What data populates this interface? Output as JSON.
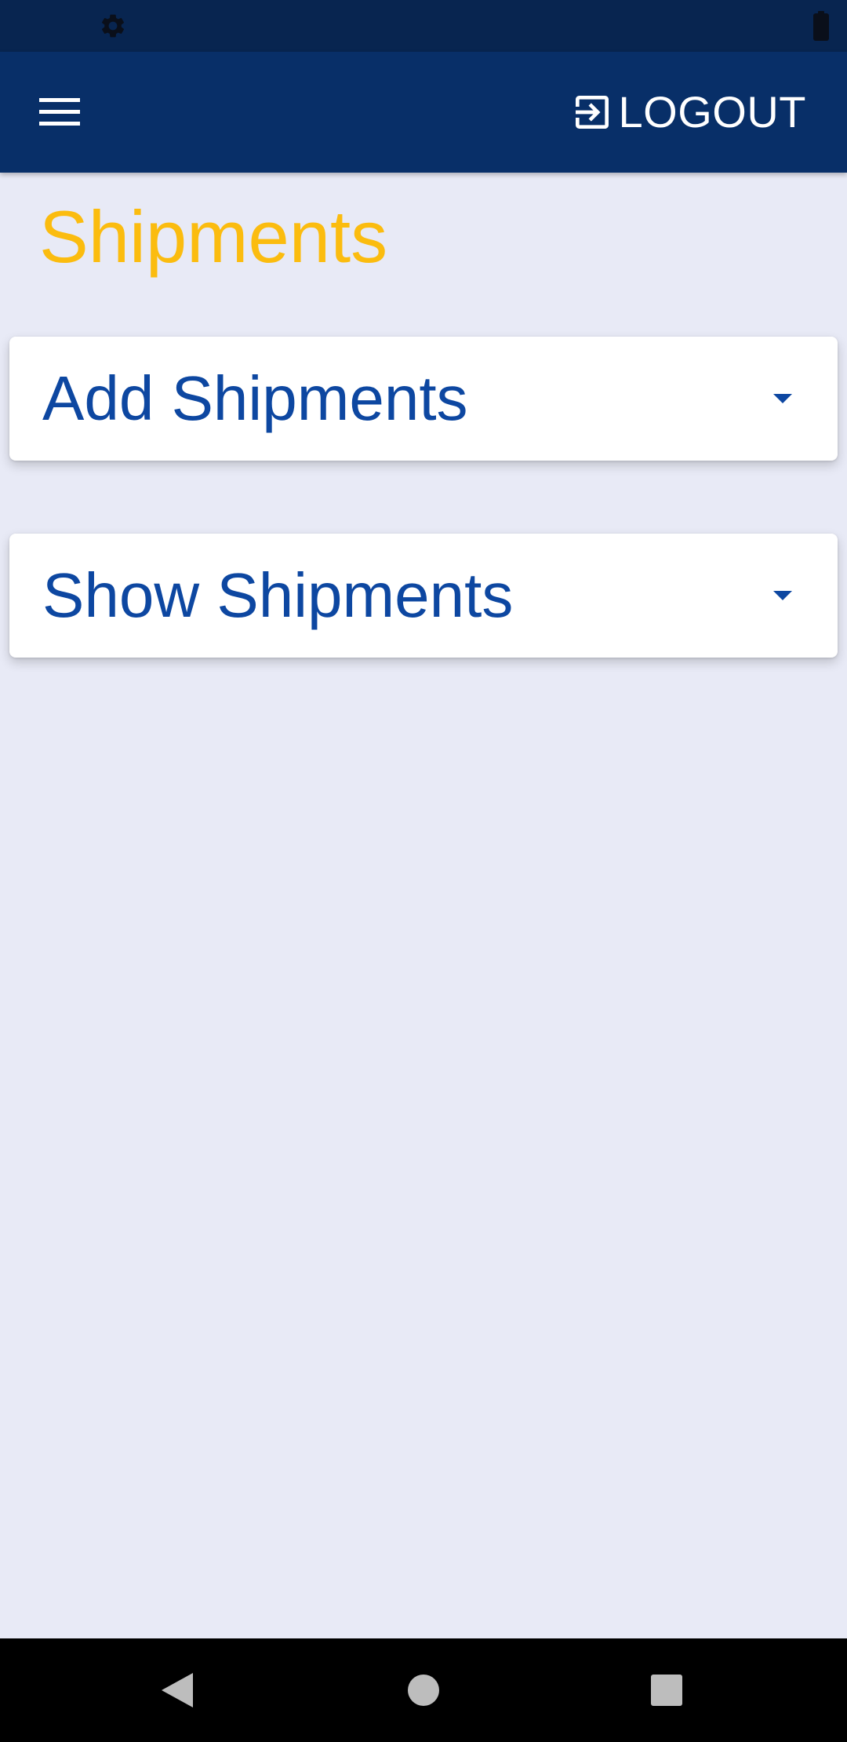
{
  "app_bar": {
    "logout_label": "LOGOUT"
  },
  "page": {
    "title": "Shipments"
  },
  "panels": [
    {
      "label": "Add Shipments",
      "expanded": false
    },
    {
      "label": "Show Shipments",
      "expanded": false
    }
  ],
  "icons": {
    "status_settings": "gear-icon",
    "status_battery": "battery-icon",
    "menu": "hamburger-menu-icon",
    "logout": "logout-icon",
    "panel_expand": "caret-down-icon",
    "nav_back": "back-triangle-icon",
    "nav_home": "home-circle-icon",
    "nav_recents": "recents-square-icon"
  },
  "colors": {
    "status_bar": "#082550",
    "app_bar": "#082f68",
    "background": "#e8eaf6",
    "title": "#fbbc0f",
    "panel_text": "#0d47a1",
    "panel_background": "#ffffff"
  }
}
